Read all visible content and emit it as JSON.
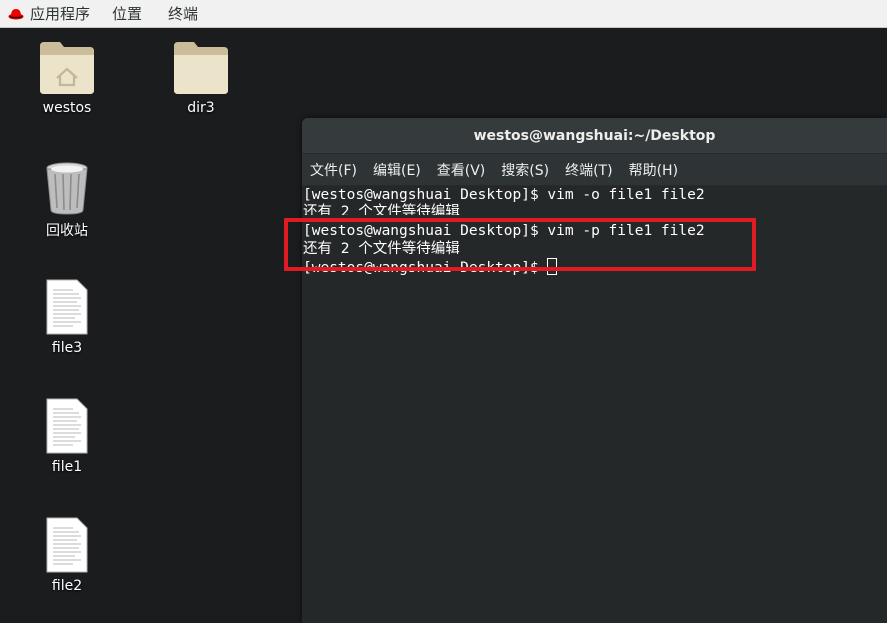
{
  "topbar": {
    "menus": [
      "应用程序",
      "位置",
      "终端"
    ]
  },
  "desktop": {
    "icons": [
      {
        "label": "westos",
        "icon": "home-folder-icon"
      },
      {
        "label": "dir3",
        "icon": "folder-icon"
      },
      {
        "label": "回收站",
        "icon": "trash-icon"
      },
      {
        "label": "file3",
        "icon": "text-file-icon"
      },
      {
        "label": "file1",
        "icon": "text-file-icon"
      },
      {
        "label": "file2",
        "icon": "text-file-icon"
      }
    ]
  },
  "terminal": {
    "title": "westos@wangshuai:~/Desktop",
    "menu": [
      "文件(F)",
      "编辑(E)",
      "查看(V)",
      "搜索(S)",
      "终端(T)",
      "帮助(H)"
    ],
    "lines": [
      "[westos@wangshuai Desktop]$ vim -o file1 file2",
      "还有 2 个文件等待编辑",
      "[westos@wangshuai Desktop]$ vim -p file1 file2",
      "还有 2 个文件等待编辑",
      "[westos@wangshuai Desktop]$ "
    ]
  },
  "colors": {
    "desktop_bg": "#1b1c1e",
    "terminal_bg": "#242829",
    "highlight": "#e01b24"
  }
}
